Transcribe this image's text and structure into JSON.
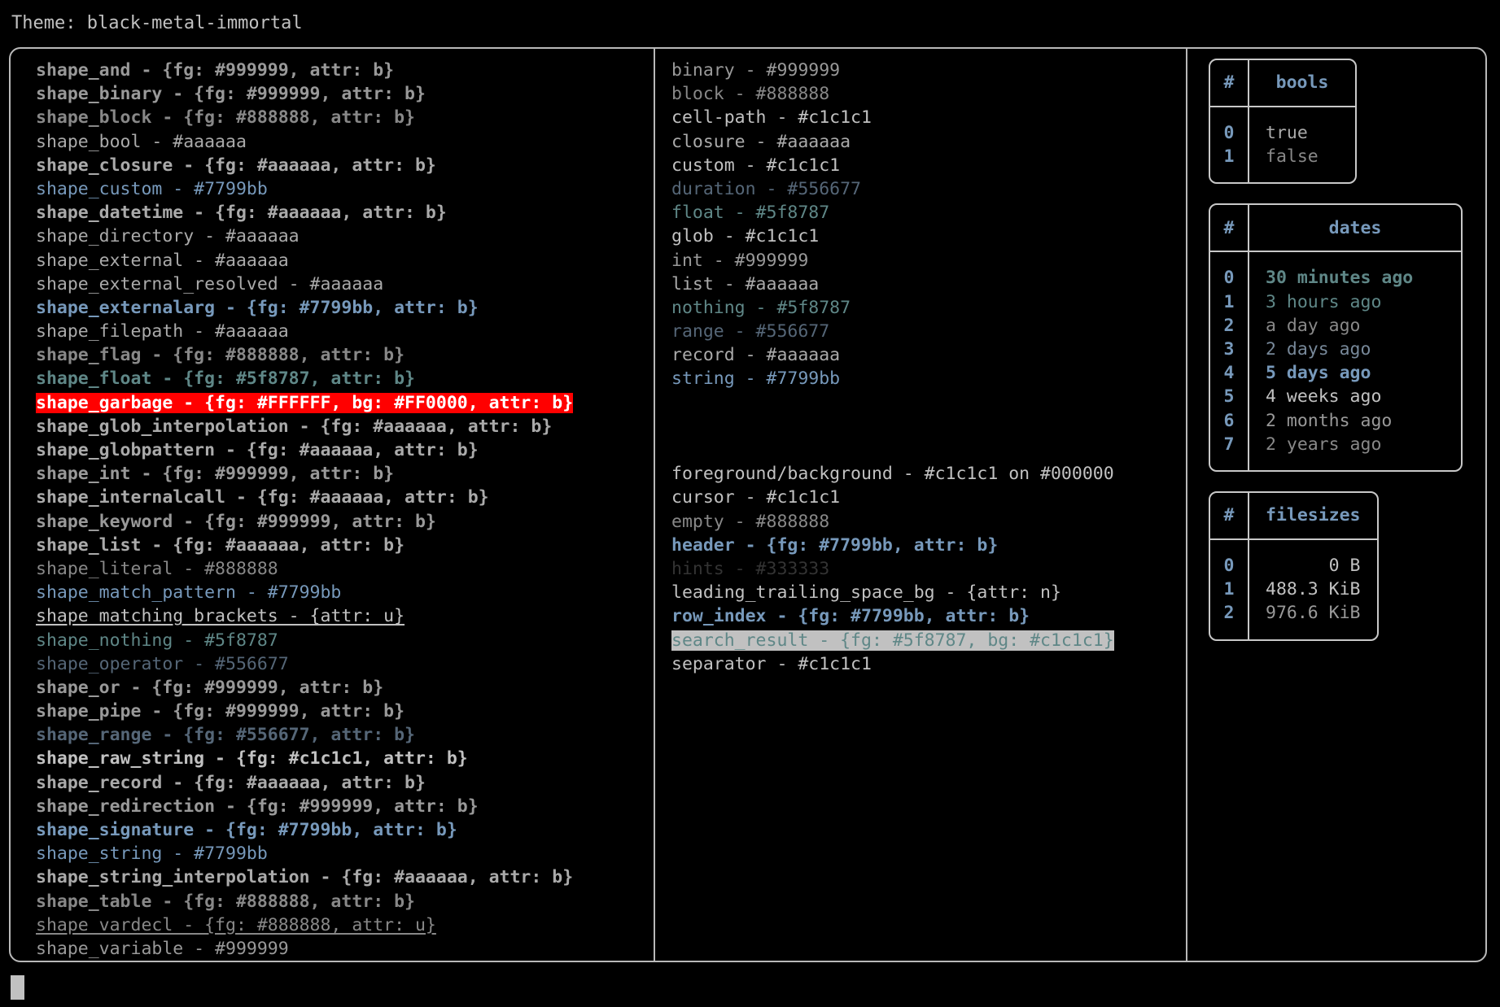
{
  "header": {
    "label": "Theme: black-metal-immortal"
  },
  "palette": {
    "background": "#000000",
    "foreground": "#c1c1c1",
    "border": "#c8c8c8",
    "accent_blue": "#7799bb",
    "teal": "#5f8787",
    "slate": "#556677",
    "gray_aaa": "#aaaaaa",
    "gray_999": "#999999",
    "gray_888": "#888888",
    "gray_333": "#333333",
    "garbage_fg": "#FFFFFF",
    "garbage_bg": "#FF0000",
    "search_result_fg": "#5f8787",
    "search_result_bg": "#c1c1c1"
  },
  "shapes_column": [
    {
      "text": "shape_and - {fg: #999999, attr: b}",
      "color": "#999999",
      "bold": true,
      "underline": false
    },
    {
      "text": "shape_binary - {fg: #999999, attr: b}",
      "color": "#999999",
      "bold": true,
      "underline": false
    },
    {
      "text": "shape_block - {fg: #888888, attr: b}",
      "color": "#888888",
      "bold": true,
      "underline": false
    },
    {
      "text": "shape_bool - #aaaaaa",
      "color": "#aaaaaa",
      "bold": false,
      "underline": false
    },
    {
      "text": "shape_closure - {fg: #aaaaaa, attr: b}",
      "color": "#aaaaaa",
      "bold": true,
      "underline": false
    },
    {
      "text": "shape_custom - #7799bb",
      "color": "#7799bb",
      "bold": false,
      "underline": false
    },
    {
      "text": "shape_datetime - {fg: #aaaaaa, attr: b}",
      "color": "#aaaaaa",
      "bold": true,
      "underline": false
    },
    {
      "text": "shape_directory - #aaaaaa",
      "color": "#aaaaaa",
      "bold": false,
      "underline": false
    },
    {
      "text": "shape_external - #aaaaaa",
      "color": "#aaaaaa",
      "bold": false,
      "underline": false
    },
    {
      "text": "shape_external_resolved - #aaaaaa",
      "color": "#aaaaaa",
      "bold": false,
      "underline": false
    },
    {
      "text": "shape_externalarg - {fg: #7799bb, attr: b}",
      "color": "#7799bb",
      "bold": true,
      "underline": false
    },
    {
      "text": "shape_filepath - #aaaaaa",
      "color": "#aaaaaa",
      "bold": false,
      "underline": false
    },
    {
      "text": "shape_flag - {fg: #888888, attr: b}",
      "color": "#888888",
      "bold": true,
      "underline": false
    },
    {
      "text": "shape_float - {fg: #5f8787, attr: b}",
      "color": "#5f8787",
      "bold": true,
      "underline": false
    },
    {
      "text": "shape_garbage - {fg: #FFFFFF, bg: #FF0000, attr: b}",
      "color": "#FFFFFF",
      "background": "#FF0000",
      "bold": true,
      "underline": false
    },
    {
      "text": "shape_glob_interpolation - {fg: #aaaaaa, attr: b}",
      "color": "#aaaaaa",
      "bold": true,
      "underline": false
    },
    {
      "text": "shape_globpattern - {fg: #aaaaaa, attr: b}",
      "color": "#aaaaaa",
      "bold": true,
      "underline": false
    },
    {
      "text": "shape_int - {fg: #999999, attr: b}",
      "color": "#999999",
      "bold": true,
      "underline": false
    },
    {
      "text": "shape_internalcall - {fg: #aaaaaa, attr: b}",
      "color": "#aaaaaa",
      "bold": true,
      "underline": false
    },
    {
      "text": "shape_keyword - {fg: #999999, attr: b}",
      "color": "#999999",
      "bold": true,
      "underline": false
    },
    {
      "text": "shape_list - {fg: #aaaaaa, attr: b}",
      "color": "#aaaaaa",
      "bold": true,
      "underline": false
    },
    {
      "text": "shape_literal - #888888",
      "color": "#888888",
      "bold": false,
      "underline": false
    },
    {
      "text": "shape_match_pattern - #7799bb",
      "color": "#7799bb",
      "bold": false,
      "underline": false
    },
    {
      "text": "shape_matching_brackets - {attr: u}",
      "color": "#c1c1c1",
      "bold": false,
      "underline": true
    },
    {
      "text": "shape_nothing - #5f8787",
      "color": "#5f8787",
      "bold": false,
      "underline": false
    },
    {
      "text": "shape_operator - #556677",
      "color": "#556677",
      "bold": false,
      "underline": false
    },
    {
      "text": "shape_or - {fg: #999999, attr: b}",
      "color": "#999999",
      "bold": true,
      "underline": false
    },
    {
      "text": "shape_pipe - {fg: #999999, attr: b}",
      "color": "#999999",
      "bold": true,
      "underline": false
    },
    {
      "text": "shape_range - {fg: #556677, attr: b}",
      "color": "#556677",
      "bold": true,
      "underline": false
    },
    {
      "text": "shape_raw_string - {fg: #c1c1c1, attr: b}",
      "color": "#c1c1c1",
      "bold": true,
      "underline": false
    },
    {
      "text": "shape_record - {fg: #aaaaaa, attr: b}",
      "color": "#aaaaaa",
      "bold": true,
      "underline": false
    },
    {
      "text": "shape_redirection - {fg: #999999, attr: b}",
      "color": "#999999",
      "bold": true,
      "underline": false
    },
    {
      "text": "shape_signature - {fg: #7799bb, attr: b}",
      "color": "#7799bb",
      "bold": true,
      "underline": false
    },
    {
      "text": "shape_string - #7799bb",
      "color": "#7799bb",
      "bold": false,
      "underline": false
    },
    {
      "text": "shape_string_interpolation - {fg: #aaaaaa, attr: b}",
      "color": "#aaaaaa",
      "bold": true,
      "underline": false
    },
    {
      "text": "shape_table - {fg: #888888, attr: b}",
      "color": "#888888",
      "bold": true,
      "underline": false
    },
    {
      "text": "shape_vardecl - {fg: #888888, attr: u}",
      "color": "#888888",
      "bold": false,
      "underline": true
    },
    {
      "text": "shape_variable - #999999",
      "color": "#999999",
      "bold": false,
      "underline": false
    }
  ],
  "types_column": [
    {
      "text": "binary - #999999",
      "color": "#999999",
      "bold": false,
      "underline": false
    },
    {
      "text": "block - #888888",
      "color": "#888888",
      "bold": false,
      "underline": false
    },
    {
      "text": "cell-path - #c1c1c1",
      "color": "#c1c1c1",
      "bold": false,
      "underline": false
    },
    {
      "text": "closure - #aaaaaa",
      "color": "#aaaaaa",
      "bold": false,
      "underline": false
    },
    {
      "text": "custom - #c1c1c1",
      "color": "#c1c1c1",
      "bold": false,
      "underline": false
    },
    {
      "text": "duration - #556677",
      "color": "#556677",
      "bold": false,
      "underline": false
    },
    {
      "text": "float - #5f8787",
      "color": "#5f8787",
      "bold": false,
      "underline": false
    },
    {
      "text": "glob - #c1c1c1",
      "color": "#c1c1c1",
      "bold": false,
      "underline": false
    },
    {
      "text": "int - #999999",
      "color": "#999999",
      "bold": false,
      "underline": false
    },
    {
      "text": "list - #aaaaaa",
      "color": "#aaaaaa",
      "bold": false,
      "underline": false
    },
    {
      "text": "nothing - #5f8787",
      "color": "#5f8787",
      "bold": false,
      "underline": false
    },
    {
      "text": "range - #556677",
      "color": "#556677",
      "bold": false,
      "underline": false
    },
    {
      "text": "record - #aaaaaa",
      "color": "#aaaaaa",
      "bold": false,
      "underline": false
    },
    {
      "text": "string - #7799bb",
      "color": "#7799bb",
      "bold": false,
      "underline": false
    }
  ],
  "ui_column": [
    {
      "text": "foreground/background - #c1c1c1 on #000000",
      "color": "#c1c1c1",
      "bold": false,
      "underline": false
    },
    {
      "text": "cursor - #c1c1c1",
      "color": "#c1c1c1",
      "bold": false,
      "underline": false
    },
    {
      "text": "empty - #888888",
      "color": "#888888",
      "bold": false,
      "underline": false
    },
    {
      "text": "header - {fg: #7799bb, attr: b}",
      "color": "#7799bb",
      "bold": true,
      "underline": false
    },
    {
      "text": "hints - #333333",
      "color": "#333333",
      "bold": false,
      "underline": false
    },
    {
      "text": "leading_trailing_space_bg - {attr: n}",
      "color": "#c1c1c1",
      "bold": false,
      "underline": false
    },
    {
      "text": "row_index - {fg: #7799bb, attr: b}",
      "color": "#7799bb",
      "bold": true,
      "underline": false
    },
    {
      "text": "search_result - {fg: #5f8787, bg: #c1c1c1}",
      "color": "#5f8787",
      "background": "#c1c1c1",
      "bold": false,
      "underline": false
    },
    {
      "text": "separator - #c1c1c1",
      "color": "#c1c1c1",
      "bold": false,
      "underline": false
    }
  ],
  "tables": [
    {
      "name": "bools",
      "index_header": "#",
      "value_header": "bools",
      "align": "left",
      "rows": [
        {
          "index": "0",
          "value": "true",
          "color": "#aaaaaa",
          "bold": false
        },
        {
          "index": "1",
          "value": "false",
          "color": "#888888",
          "bold": false
        }
      ]
    },
    {
      "name": "dates",
      "index_header": "#",
      "value_header": "dates",
      "align": "left",
      "rows": [
        {
          "index": "0",
          "value": "30 minutes ago",
          "color": "#5f8787",
          "bold": true
        },
        {
          "index": "1",
          "value": "3 hours ago",
          "color": "#5f8787",
          "bold": false
        },
        {
          "index": "2",
          "value": "a day ago",
          "color": "#888888",
          "bold": false
        },
        {
          "index": "3",
          "value": "2 days ago",
          "color": "#778899",
          "bold": false
        },
        {
          "index": "4",
          "value": "5 days ago",
          "color": "#7799bb",
          "bold": true
        },
        {
          "index": "5",
          "value": "4 weeks ago",
          "color": "#c1c1c1",
          "bold": false
        },
        {
          "index": "6",
          "value": "2 months ago",
          "color": "#999999",
          "bold": false
        },
        {
          "index": "7",
          "value": "2 years ago",
          "color": "#888888",
          "bold": false
        }
      ]
    },
    {
      "name": "filesizes",
      "index_header": "#",
      "value_header": "filesizes",
      "align": "right",
      "rows": [
        {
          "index": "0",
          "value": "0 B",
          "color": "#c1c1c1",
          "bold": false
        },
        {
          "index": "1",
          "value": "488.3 KiB",
          "color": "#c1c1c1",
          "bold": false
        },
        {
          "index": "2",
          "value": "976.6 KiB",
          "color": "#999999",
          "bold": false
        }
      ]
    }
  ],
  "cursor": {
    "visible": true
  }
}
